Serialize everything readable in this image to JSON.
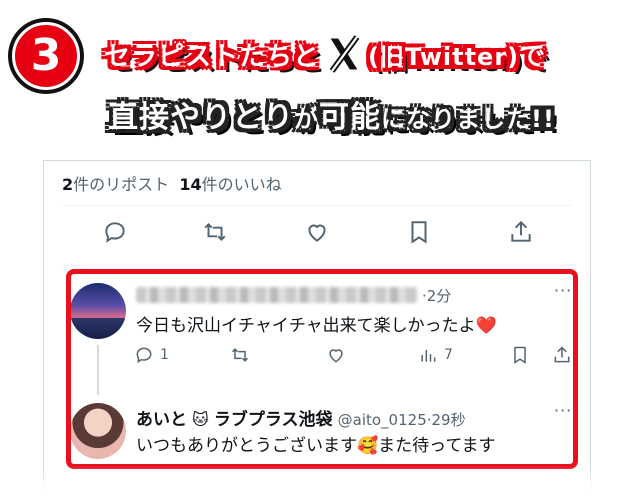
{
  "banner": {
    "step_number": "3",
    "line1_text": "セラピストたちと",
    "old_twitter": "(旧Twitter)",
    "line1_suffix": "で",
    "line2_a": "直接やりとり",
    "line2_b": "が",
    "line2_c": "可能",
    "line2_d": "になりました!!",
    "accent_color": "#e60012"
  },
  "stats": {
    "reposts_count": "2",
    "reposts_label": "件のリポスト",
    "likes_count": "14",
    "likes_label": "件のいいね"
  },
  "main_actions": [
    "reply-icon",
    "repost-icon",
    "like-icon",
    "bookmark-icon",
    "share-icon"
  ],
  "reply1": {
    "name": "",
    "time": "·2分",
    "text": "今日も沢山イチャイチャ出来て楽しかったよ",
    "emoji": "❤️",
    "reply_count": "1",
    "views_count": "7",
    "more": "···"
  },
  "reply2": {
    "name": "あいと",
    "emoji_badge": "🐱",
    "shop": "ラブプラス池袋",
    "handle": "@aito_0125",
    "time": "·29秒",
    "text": "いつもありがとうございます",
    "emoji": "🥰",
    "text2": "また待ってます",
    "more": "···"
  }
}
